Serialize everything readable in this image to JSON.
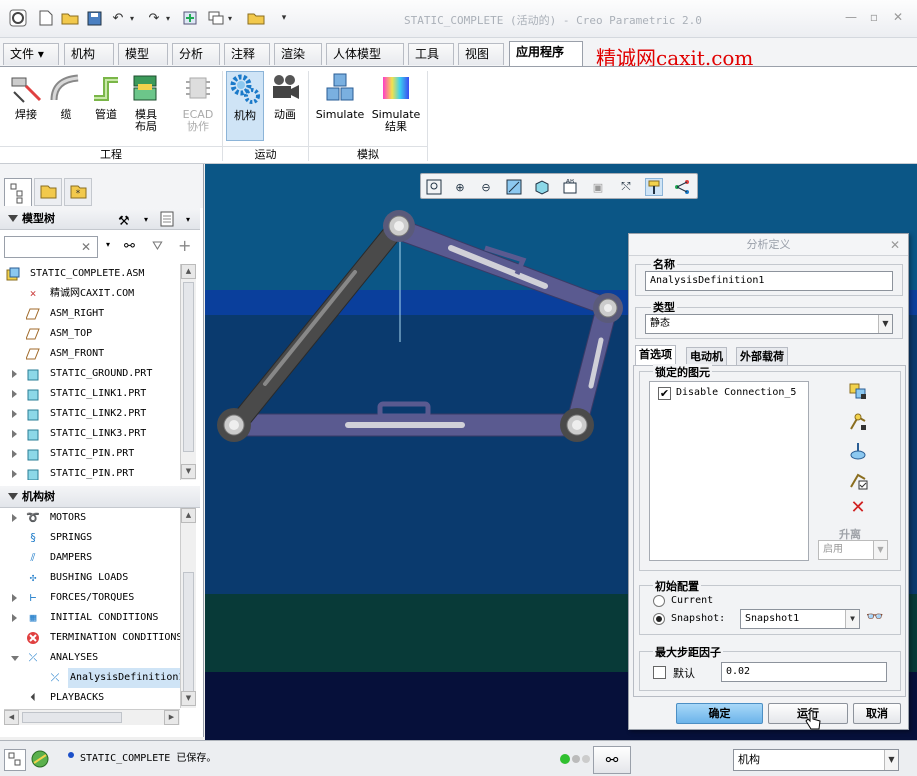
{
  "window": {
    "title": "STATIC_COMPLETE (活动的) - Creo Parametric 2.0"
  },
  "brand_text": "精诚网caxit.com",
  "ribbon_tabs": [
    {
      "label": "文件 ▾",
      "active": false
    },
    {
      "label": "机构",
      "active": false
    },
    {
      "label": "模型",
      "active": false
    },
    {
      "label": "分析",
      "active": false
    },
    {
      "label": "注释",
      "active": false
    },
    {
      "label": "渲染",
      "active": false
    },
    {
      "label": "人体模型",
      "active": false
    },
    {
      "label": "工具",
      "active": false
    },
    {
      "label": "视图",
      "active": false
    },
    {
      "label": "应用程序",
      "active": true
    }
  ],
  "ribbon": {
    "buttons": {
      "weld": "焊接",
      "cabling": "缆",
      "piping": "管道",
      "mold_line1": "模具",
      "mold_line2": "布局",
      "ecad_line1": "ECAD",
      "ecad_line2": "协作",
      "mechanism": "机构",
      "animation": "动画",
      "simulate": "Simulate",
      "simulate_results_line1": "Simulate",
      "simulate_results_line2": "结果"
    },
    "groups": {
      "engineering": "工程",
      "motion": "运动",
      "simulation": "模拟"
    }
  },
  "model_tree": {
    "header": "模型树",
    "items": [
      {
        "label": "STATIC_COMPLETE.ASM",
        "icon": "assembly-icon",
        "expand": false
      },
      {
        "label": "精诚网CAXIT.COM",
        "icon": "csys-icon",
        "expand": false
      },
      {
        "label": "ASM_RIGHT",
        "icon": "datum-plane-icon",
        "expand": false
      },
      {
        "label": "ASM_TOP",
        "icon": "datum-plane-icon",
        "expand": false
      },
      {
        "label": "ASM_FRONT",
        "icon": "datum-plane-icon",
        "expand": false
      },
      {
        "label": "STATIC_GROUND.PRT",
        "icon": "part-icon",
        "expand": true
      },
      {
        "label": "STATIC_LINK1.PRT",
        "icon": "part-icon",
        "expand": true
      },
      {
        "label": "STATIC_LINK2.PRT",
        "icon": "part-icon",
        "expand": true
      },
      {
        "label": "STATIC_LINK3.PRT",
        "icon": "part-icon",
        "expand": true
      },
      {
        "label": "STATIC_PIN.PRT",
        "icon": "part-icon",
        "expand": true
      },
      {
        "label": "STATIC_PIN.PRT",
        "icon": "part-icon",
        "expand": true
      }
    ]
  },
  "mech_tree": {
    "header": "机构树",
    "items": [
      {
        "label": "MOTORS",
        "icon": "motor-icon",
        "expand": "closed"
      },
      {
        "label": "SPRINGS",
        "icon": "spring-icon",
        "expand": "none"
      },
      {
        "label": "DAMPERS",
        "icon": "damper-icon",
        "expand": "none"
      },
      {
        "label": "BUSHING LOADS",
        "icon": "bushing-icon",
        "expand": "none"
      },
      {
        "label": "FORCES/TORQUES",
        "icon": "force-icon",
        "expand": "closed"
      },
      {
        "label": "INITIAL CONDITIONS",
        "icon": "initial-condition-icon",
        "expand": "closed"
      },
      {
        "label": "TERMINATION CONDITIONS",
        "icon": "termination-icon",
        "expand": "none"
      },
      {
        "label": "ANALYSES",
        "icon": "analysis-icon",
        "expand": "open"
      },
      {
        "label": "AnalysisDefinition1",
        "icon": "analysis-icon",
        "expand": "child"
      },
      {
        "label": "PLAYBACKS",
        "icon": "playback-icon",
        "expand": "none"
      }
    ]
  },
  "dialog": {
    "title": "分析定义",
    "name_label": "名称",
    "name_value": "AnalysisDefinition1",
    "type_label": "类型",
    "type_value": "静态",
    "tabs": [
      "首选项",
      "电动机",
      "外部载荷"
    ],
    "locked_label": "锁定的图元",
    "locked_items": [
      {
        "label": "Disable Connection_5",
        "checked": true
      }
    ],
    "lift_label": "升离",
    "lift_value": "启用",
    "initial_config_label": "初始配置",
    "current_label": "Current",
    "snapshot_label": "Snapshot:",
    "snapshot_value": "Snapshot1",
    "max_step_label": "最大步距因子",
    "default_label": "默认",
    "max_step_value": "0.02",
    "ok": "确定",
    "run": "运行",
    "cancel": "取消"
  },
  "status": {
    "message": "STATIC_COMPLETE 已保存。",
    "filter_value": "机构"
  },
  "colors": {
    "viewport_bg": "#0b4f7f",
    "link_dark": "#4a4a4a",
    "link_blue": "#5a5a90",
    "brand_red": "#e00000",
    "primary_button": "#6cb4ea"
  }
}
